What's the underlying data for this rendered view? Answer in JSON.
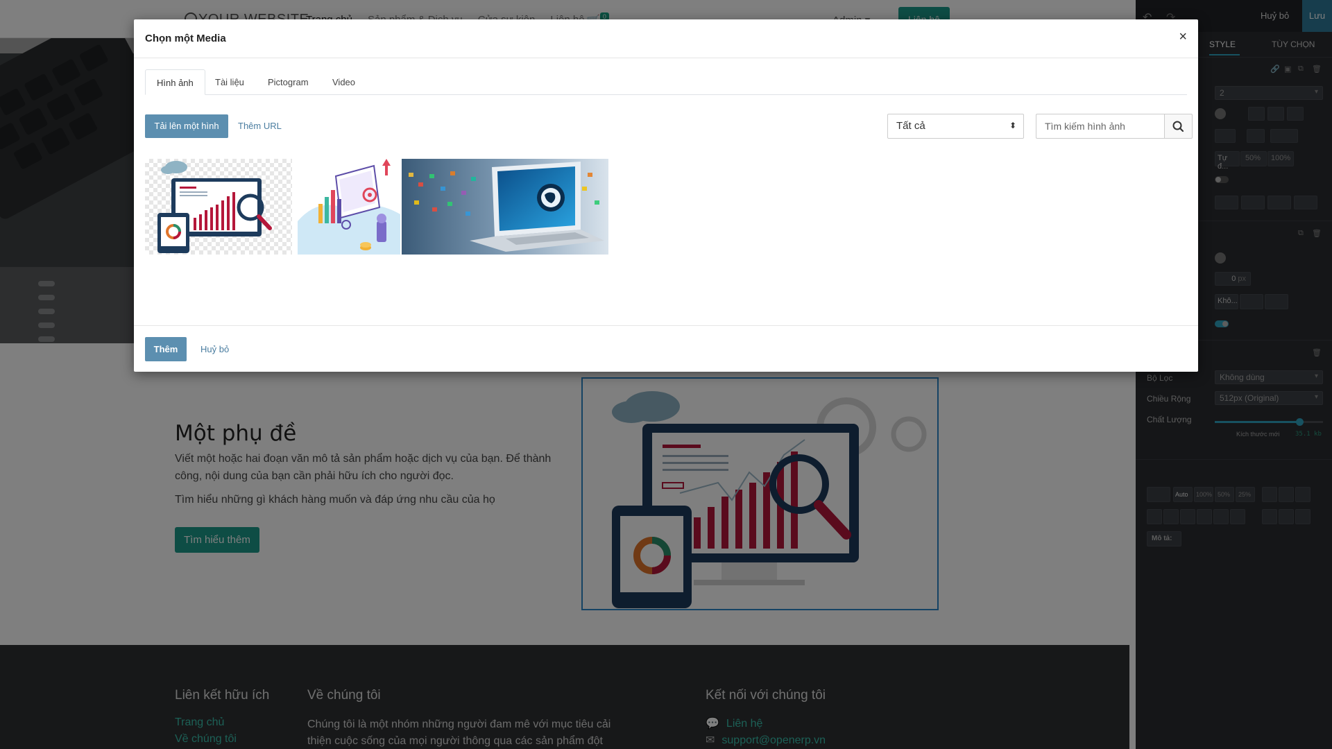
{
  "site": {
    "logo_text": "YOUR WEBSITE",
    "nav_items": [
      "Trang chủ",
      "Sản phẩm & Dịch vụ",
      "Cửa sự kiện",
      "Liên hệ"
    ],
    "cart_count": "0",
    "admin_label": "Admin",
    "contact_button": "Liên hệ"
  },
  "content": {
    "subtitle": "Một phụ đề",
    "paragraph1": "Viết một hoặc hai đoạn văn mô tả sản phẩm hoặc dịch vụ của bạn. Để thành công, nội dung của bạn cần phải hữu ích cho người đọc.",
    "paragraph2": "Tìm hiểu những gì khách hàng muốn và đáp ứng nhu cầu của họ",
    "learn_more": "Tìm hiểu thêm"
  },
  "footer": {
    "col1_title": "Liên kết hữu ích",
    "col1_links": [
      "Trang chủ",
      "Về chúng tôi"
    ],
    "col2_title": "Về chúng tôi",
    "col2_text": "Chúng tôi là một nhóm những người đam mê với mục tiêu cải thiện cuộc sống của mọi người thông qua các sản phẩm đột",
    "col3_title": "Kết nối với chúng tôi",
    "col3_links": [
      "Liên hệ",
      "support@openerp.vn"
    ]
  },
  "editor": {
    "cancel_label": "Huỷ bỏ",
    "save_label": "Lưu",
    "tabs": [
      "STYLE",
      "TÙY CHỌN"
    ],
    "field_value": "2",
    "auto_label": "Tự đ...",
    "pct_buttons": [
      "50%",
      "100%"
    ],
    "px_value": "0",
    "px_unit": "px",
    "kho_label": "Khô...",
    "filter_label": "Bộ Lọc",
    "filter_value": "Không dùng",
    "width_label": "Chiều Rộng",
    "width_value": "512px (Original)",
    "quality_label": "Chất Lượng",
    "quality_value": 0.78,
    "new_size_label": "Kích thước mới",
    "new_size_value": "35.1 kb",
    "size_buttons": [
      "Auto",
      "100%",
      "50%",
      "25%"
    ],
    "desc_label": "Mô tả:"
  },
  "modal": {
    "title": "Chọn một Media",
    "close": "×",
    "tabs": [
      "Hình ảnh",
      "Tài liệu",
      "Pictogram",
      "Video"
    ],
    "active_tab": 0,
    "upload_button": "Tải lên một hình",
    "add_url": "Thêm URL",
    "filter_value": "Tất cả",
    "search_placeholder": "Tìm kiếm hình ảnh",
    "add_button": "Thêm",
    "cancel_button": "Huỷ bỏ"
  },
  "colors": {
    "primary": "#5c8fb0",
    "teal": "#1d9a8a",
    "footer_link": "#39c1ad",
    "chart_red": "#b5173a",
    "chart_navy": "#1d3b5c"
  }
}
